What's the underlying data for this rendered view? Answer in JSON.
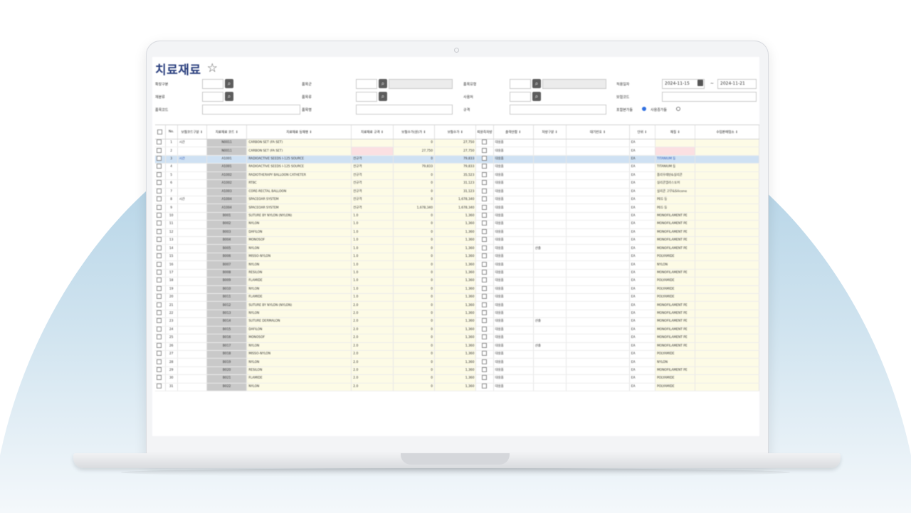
{
  "page": {
    "title": "치료재료",
    "favorite_icon": "star-outline-icon"
  },
  "filters": {
    "row1": [
      {
        "label": "확장구분",
        "icon": "search-icon"
      },
      {
        "label": "품목군",
        "icon": "search-icon"
      },
      {
        "label": "품목유형",
        "icon": "search-icon"
      },
      {
        "label": "적용일자",
        "date_from": "2024-11-15",
        "date_sep": "~",
        "date_to": "2024-11-21",
        "icon": "calendar-icon"
      }
    ],
    "row2": [
      {
        "label": "재분류",
        "icon": "search-icon"
      },
      {
        "label": "품목류",
        "icon": "search-icon"
      },
      {
        "label": "사용처",
        "icon": "search-icon"
      },
      {
        "label": "보험코드"
      }
    ],
    "row3": [
      {
        "label": "품목코드"
      },
      {
        "label": "품목명"
      },
      {
        "label": "규격"
      },
      {
        "label": "포함본가들",
        "radio1_on": true,
        "label2": "사용중가들",
        "radio2_on": false
      }
    ]
  },
  "grid": {
    "columns": [
      "",
      "No.",
      "보험코드구분 ↕",
      "치료재료 코드 ↕",
      "치료재료 등재명 ↕",
      "치료재료 규격 ↕",
      "보험수가(원)가 ↕",
      "보험수가 ↕",
      "퇴원즉처방",
      "출력안함 ↕",
      "처방구분 ↕",
      "대기번호 ↕",
      "단위 ↕",
      "재질 ↕",
      "수입판매업소 ↕"
    ],
    "rows": [
      {
        "no": "1",
        "kind": "시간",
        "code": "N0011",
        "name": "CARBON SET (FA SET)",
        "spec": "",
        "base": "0",
        "price": "27,750",
        "out": "대용품",
        "unit": "EA",
        "mat": ""
      },
      {
        "no": "2",
        "kind": "",
        "code": "N0011",
        "name": "CARBON SET (FA SET)",
        "spec": "",
        "base": "27,750",
        "price": "27,750",
        "out": "대용품",
        "unit": "EA",
        "mat": "",
        "pink": true
      },
      {
        "no": "3",
        "kind": "시간",
        "code": "A1001",
        "name": "RADIOACTIVE SEEDS I-125 SOURCE",
        "spec": "전규격",
        "base": "0",
        "price": "79,833",
        "out": "대용품",
        "unit": "EA",
        "mat": "TITANIUM 등",
        "sel": true
      },
      {
        "no": "4",
        "kind": "",
        "code": "A1001",
        "name": "RADIOACTIVE SEEDS I-125 SOURCE",
        "spec": "전규격",
        "base": "79,833",
        "price": "79,833",
        "out": "대용품",
        "unit": "EA",
        "mat": "TITANIUM 등"
      },
      {
        "no": "5",
        "kind": "",
        "code": "A1002",
        "name": "RADIOTHERAPY BALLOON CATHETER",
        "spec": "전규격",
        "base": "0",
        "price": "35,523",
        "out": "대용품",
        "unit": "EA",
        "mat": "폴리우레탄&실리콘"
      },
      {
        "no": "6",
        "kind": "",
        "code": "A1002",
        "name": "RTBC",
        "spec": "전규격",
        "base": "0",
        "price": "31,123",
        "out": "대용품",
        "unit": "EA",
        "mat": "실리콘엘라스토머"
      },
      {
        "no": "7",
        "kind": "",
        "code": "A1003",
        "name": "CORE-RECTAL BALLOON",
        "spec": "전규격",
        "base": "0",
        "price": "31,123",
        "out": "대용품",
        "unit": "EA",
        "mat": "실리콘 고무&Silicone"
      },
      {
        "no": "8",
        "kind": "시간",
        "code": "A1004",
        "name": "SPACEOAR SYSTEM",
        "spec": "전규격",
        "base": "0",
        "price": "1,678,340",
        "out": "대용품",
        "unit": "EA",
        "mat": "PEG 등"
      },
      {
        "no": "9",
        "kind": "",
        "code": "A1004",
        "name": "SPACEOAR SYSTEM",
        "spec": "전규격",
        "base": "1,678,340",
        "price": "1,678,340",
        "out": "대용품",
        "unit": "EA",
        "mat": "PEG 등"
      },
      {
        "no": "10",
        "kind": "",
        "code": "B001",
        "name": "SUTURE BY NYLON (NYLON)",
        "spec": "1.0",
        "base": "0",
        "price": "1,360",
        "out": "대용품",
        "unit": "EA",
        "mat": "MONOFILAMENT PE"
      },
      {
        "no": "11",
        "kind": "",
        "code": "B002",
        "name": "NYLON",
        "spec": "1.0",
        "base": "0",
        "price": "1,360",
        "out": "대용품",
        "unit": "EA",
        "mat": "MONOFILAMENT PE"
      },
      {
        "no": "12",
        "kind": "",
        "code": "B003",
        "name": "DAFILON",
        "spec": "1.0",
        "base": "0",
        "price": "1,360",
        "out": "대용품",
        "unit": "EA",
        "mat": "MONOFILAMENT PE"
      },
      {
        "no": "13",
        "kind": "",
        "code": "B004",
        "name": "MONOSOF",
        "spec": "1.0",
        "base": "0",
        "price": "1,360",
        "out": "대용품",
        "unit": "EA",
        "mat": "MONOFILAMENT PE"
      },
      {
        "no": "14",
        "kind": "",
        "code": "B005",
        "name": "NYLON",
        "spec": "1.0",
        "base": "0",
        "price": "1,360",
        "out": "대용품",
        "proc": "산출",
        "unit": "EA",
        "mat": "MONOFILAMENT PE"
      },
      {
        "no": "15",
        "kind": "",
        "code": "B006",
        "name": "MISSO-NYLON",
        "spec": "1.0",
        "base": "0",
        "price": "1,360",
        "out": "대용품",
        "unit": "EA",
        "mat": "POLYAMIDE"
      },
      {
        "no": "16",
        "kind": "",
        "code": "B007",
        "name": "NYLON",
        "spec": "1.0",
        "base": "0",
        "price": "1,360",
        "out": "대용품",
        "unit": "EA",
        "mat": "NYLON"
      },
      {
        "no": "17",
        "kind": "",
        "code": "B008",
        "name": "RESILON",
        "spec": "1.0",
        "base": "0",
        "price": "1,360",
        "out": "대용품",
        "unit": "EA",
        "mat": "MONOFILAMENT PE"
      },
      {
        "no": "18",
        "kind": "",
        "code": "B009",
        "name": "FLAMIDE",
        "spec": "1.0",
        "base": "0",
        "price": "1,360",
        "out": "대용품",
        "unit": "EA",
        "mat": "POLYAMIDE"
      },
      {
        "no": "19",
        "kind": "",
        "code": "B010",
        "name": "NYLON",
        "spec": "1.0",
        "base": "0",
        "price": "1,360",
        "out": "대용품",
        "unit": "EA",
        "mat": "POLYAMIDE"
      },
      {
        "no": "20",
        "kind": "",
        "code": "B011",
        "name": "FLAMIDE",
        "spec": "1.0",
        "base": "0",
        "price": "1,360",
        "out": "대용품",
        "unit": "EA",
        "mat": "POLYAMIDE"
      },
      {
        "no": "21",
        "kind": "",
        "code": "B012",
        "name": "SUTURE BY NYLON (NYLON)",
        "spec": "2.0",
        "base": "0",
        "price": "1,360",
        "out": "대용품",
        "unit": "EA",
        "mat": "MONOFILAMENT PE"
      },
      {
        "no": "22",
        "kind": "",
        "code": "B013",
        "name": "NYLON",
        "spec": "2.0",
        "base": "0",
        "price": "1,360",
        "out": "대용품",
        "unit": "EA",
        "mat": "MONOFILAMENT PE"
      },
      {
        "no": "23",
        "kind": "",
        "code": "B014",
        "name": "SUTURE DERMALON",
        "spec": "2.0",
        "base": "0",
        "price": "1,360",
        "out": "대용품",
        "proc": "산출",
        "unit": "EA",
        "mat": "MONOFILAMENT PE"
      },
      {
        "no": "24",
        "kind": "",
        "code": "B015",
        "name": "DAFILON",
        "spec": "2.0",
        "base": "0",
        "price": "1,360",
        "out": "대용품",
        "unit": "EA",
        "mat": "MONOFILAMENT PE"
      },
      {
        "no": "25",
        "kind": "",
        "code": "B016",
        "name": "MONOSOF",
        "spec": "2.0",
        "base": "0",
        "price": "1,360",
        "out": "대용품",
        "unit": "EA",
        "mat": "MONOFILAMENT PE"
      },
      {
        "no": "26",
        "kind": "",
        "code": "B017",
        "name": "NYLON",
        "spec": "2.0",
        "base": "0",
        "price": "1,360",
        "out": "대용품",
        "proc": "산출",
        "unit": "EA",
        "mat": "MONOFILAMENT PE"
      },
      {
        "no": "27",
        "kind": "",
        "code": "B018",
        "name": "MISSO-NYLON",
        "spec": "2.0",
        "base": "0",
        "price": "1,360",
        "out": "대용품",
        "unit": "EA",
        "mat": "POLYAMIDE"
      },
      {
        "no": "28",
        "kind": "",
        "code": "B019",
        "name": "NYLON",
        "spec": "2.0",
        "base": "0",
        "price": "1,360",
        "out": "대용품",
        "unit": "EA",
        "mat": "NYLON"
      },
      {
        "no": "29",
        "kind": "",
        "code": "B020",
        "name": "RESILON",
        "spec": "2.0",
        "base": "0",
        "price": "1,360",
        "out": "대용품",
        "unit": "EA",
        "mat": "MONOFILAMENT PE"
      },
      {
        "no": "30",
        "kind": "",
        "code": "B021",
        "name": "FLAMIDE",
        "spec": "2.0",
        "base": "0",
        "price": "1,360",
        "out": "대용품",
        "unit": "EA",
        "mat": "POLYAMIDE"
      },
      {
        "no": "31",
        "kind": "",
        "code": "B022",
        "name": "NYLON",
        "spec": "2.0",
        "base": "0",
        "price": "1,360",
        "out": "대용품",
        "unit": "EA",
        "mat": "POLYAMIDE"
      }
    ]
  },
  "colors": {
    "title": "#2a3f7e",
    "selected_row": "#cfe1f3",
    "code_cell": "#c9c9c9",
    "yellow_cell": "#fdfbe6",
    "pink_cell": "#fbe0e2",
    "background_arc_top": "#aecfe4",
    "background_arc_bottom": "#eef5fa"
  }
}
